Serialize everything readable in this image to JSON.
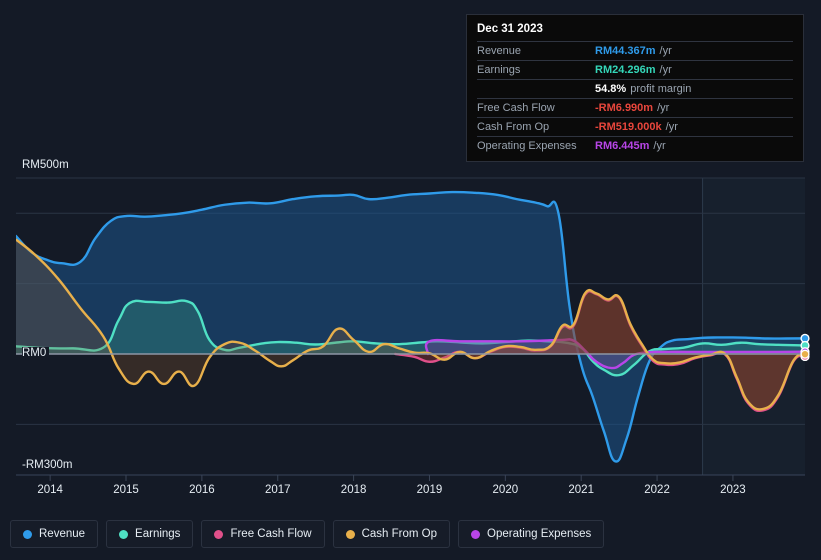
{
  "tooltip": {
    "date": "Dec 31 2023",
    "rows": [
      {
        "label": "Revenue",
        "value": "RM44.367m",
        "unit": "/yr",
        "color": "#2f9bea"
      },
      {
        "label": "Earnings",
        "value": "RM24.296m",
        "unit": "/yr",
        "color": "#34d6b8"
      },
      {
        "label": "",
        "value": "54.8%",
        "unit": "profit margin",
        "color": "#ffffff"
      },
      {
        "label": "Free Cash Flow",
        "value": "-RM6.990m",
        "unit": "/yr",
        "color": "#e8463c"
      },
      {
        "label": "Cash From Op",
        "value": "-RM519.000k",
        "unit": "/yr",
        "color": "#e8463c"
      },
      {
        "label": "Operating Expenses",
        "value": "RM6.445m",
        "unit": "/yr",
        "color": "#b845e8"
      }
    ]
  },
  "legend": {
    "items": [
      {
        "label": "Revenue",
        "color": "#2f9bea"
      },
      {
        "label": "Earnings",
        "color": "#4fe0c4"
      },
      {
        "label": "Free Cash Flow",
        "color": "#e0508a"
      },
      {
        "label": "Cash From Op",
        "color": "#e8b04b"
      },
      {
        "label": "Operating Expenses",
        "color": "#b845e8"
      }
    ]
  },
  "axes": {
    "y_labels": [
      "RM500m",
      "RM0",
      "-RM300m"
    ],
    "x_labels": [
      "2014",
      "2015",
      "2016",
      "2017",
      "2018",
      "2019",
      "2020",
      "2021",
      "2022",
      "2023"
    ]
  },
  "chart_data": {
    "type": "area",
    "title": "",
    "xlabel": "",
    "ylabel": "",
    "currency": "RM",
    "ylim": [
      -300,
      500
    ],
    "xlim": [
      2013.55,
      2023.95
    ],
    "grid": true,
    "legend_position": "bottom",
    "y_ticks": [
      500,
      400,
      200,
      0,
      -200
    ],
    "y_tick_labels": [
      "RM500m",
      "",
      "",
      "RM0",
      "-RM300m"
    ],
    "x_ticks": [
      2014,
      2015,
      2016,
      2017,
      2018,
      2019,
      2020,
      2021,
      2022,
      2023
    ],
    "forecast_region_start": 2022.6,
    "series": [
      {
        "name": "Revenue",
        "color": "#2f9bea",
        "fill": "rgba(27,86,140,0.55)",
        "x": [
          2013.55,
          2013.75,
          2013.95,
          2014.15,
          2014.4,
          2014.6,
          2014.8,
          2015.0,
          2015.25,
          2015.5,
          2015.75,
          2016.0,
          2016.3,
          2016.6,
          2016.9,
          2017.2,
          2017.5,
          2017.8,
          2018.0,
          2018.2,
          2018.45,
          2018.7,
          2019.0,
          2019.3,
          2019.6,
          2019.9,
          2020.15,
          2020.4,
          2020.55,
          2020.7,
          2020.85,
          2021.0,
          2021.15,
          2021.3,
          2021.45,
          2021.6,
          2021.75,
          2021.9,
          2022.05,
          2022.2,
          2022.4,
          2022.6,
          2022.8,
          2023.0,
          2023.2,
          2023.45,
          2023.7,
          2023.95
        ],
        "y": [
          335,
          290,
          268,
          258,
          262,
          330,
          378,
          392,
          390,
          394,
          400,
          410,
          424,
          430,
          428,
          440,
          448,
          450,
          452,
          440,
          444,
          452,
          456,
          460,
          458,
          452,
          440,
          430,
          420,
          400,
          130,
          -30,
          -120,
          -220,
          -305,
          -240,
          -120,
          -20,
          20,
          38,
          42,
          46,
          47,
          47,
          46,
          44,
          44,
          44.367
        ]
      },
      {
        "name": "Earnings",
        "color": "#4fe0c4",
        "fill": "rgba(46,130,122,0.45)",
        "x": [
          2013.55,
          2013.9,
          2014.3,
          2014.7,
          2014.9,
          2015.05,
          2015.3,
          2015.55,
          2015.8,
          2015.95,
          2016.1,
          2016.3,
          2016.5,
          2016.8,
          2017.0,
          2017.25,
          2017.5,
          2017.8,
          2018.0,
          2018.3,
          2018.6,
          2018.9,
          2019.1,
          2019.4,
          2019.7,
          2020.0,
          2020.3,
          2020.55,
          2020.8,
          2021.0,
          2021.15,
          2021.3,
          2021.5,
          2021.7,
          2021.9,
          2022.1,
          2022.35,
          2022.6,
          2022.85,
          2023.1,
          2023.35,
          2023.6,
          2023.95
        ],
        "y": [
          22,
          17,
          16,
          18,
          95,
          145,
          148,
          146,
          150,
          120,
          40,
          12,
          18,
          30,
          34,
          32,
          27,
          33,
          36,
          30,
          28,
          33,
          36,
          33,
          30,
          34,
          38,
          36,
          32,
          18,
          -20,
          -45,
          -60,
          -30,
          8,
          14,
          18,
          30,
          26,
          32,
          28,
          26,
          24.296
        ]
      },
      {
        "name": "Free Cash Flow",
        "color": "#e0508a",
        "fill": "rgba(140,52,52,0.45)",
        "x": [
          2018.55,
          2018.8,
          2019.0,
          2019.2,
          2019.4,
          2019.6,
          2019.8,
          2020.0,
          2020.2,
          2020.4,
          2020.6,
          2020.75,
          2020.9,
          2021.05,
          2021.2,
          2021.35,
          2021.5,
          2021.65,
          2021.8,
          2021.95,
          2022.1,
          2022.3,
          2022.5,
          2022.7,
          2022.9,
          2023.05,
          2023.2,
          2023.4,
          2023.6,
          2023.8,
          2023.95
        ],
        "y": [
          0,
          -8,
          -22,
          -10,
          6,
          -12,
          6,
          20,
          18,
          10,
          22,
          76,
          80,
          168,
          170,
          152,
          160,
          80,
          24,
          -20,
          -30,
          -28,
          -12,
          -4,
          -2,
          -70,
          -140,
          -160,
          -120,
          -20,
          -6.99
        ]
      },
      {
        "name": "Cash From Op",
        "color": "#e8b04b",
        "fill": "rgba(150,95,45,0.25)",
        "x": [
          2013.55,
          2013.8,
          2014.1,
          2014.4,
          2014.7,
          2014.9,
          2015.1,
          2015.3,
          2015.5,
          2015.7,
          2015.9,
          2016.1,
          2016.3,
          2016.5,
          2016.7,
          2016.9,
          2017.05,
          2017.2,
          2017.4,
          2017.6,
          2017.8,
          2018.0,
          2018.2,
          2018.4,
          2018.6,
          2018.8,
          2019.0,
          2019.2,
          2019.4,
          2019.6,
          2019.8,
          2020.0,
          2020.2,
          2020.4,
          2020.6,
          2020.75,
          2020.9,
          2021.05,
          2021.2,
          2021.35,
          2021.5,
          2021.65,
          2021.8,
          2021.95,
          2022.1,
          2022.3,
          2022.5,
          2022.7,
          2022.9,
          2023.05,
          2023.2,
          2023.4,
          2023.6,
          2023.8,
          2023.95
        ],
        "y": [
          325,
          282,
          215,
          130,
          50,
          -40,
          -85,
          -50,
          -85,
          -50,
          -90,
          -10,
          28,
          32,
          10,
          -20,
          -35,
          -18,
          10,
          22,
          72,
          40,
          6,
          28,
          16,
          4,
          2,
          -16,
          6,
          -12,
          8,
          22,
          20,
          12,
          24,
          80,
          84,
          172,
          172,
          155,
          162,
          84,
          28,
          -16,
          -26,
          -24,
          -10,
          -2,
          0,
          -66,
          -136,
          -156,
          -116,
          -18,
          -0.519
        ]
      },
      {
        "name": "Operating Expenses",
        "color": "#b845e8",
        "fill": "rgba(110,50,150,0.40)",
        "x": [
          2018.98,
          2019.0,
          2019.4,
          2019.8,
          2020.2,
          2020.5,
          2020.75,
          2020.9,
          2021.05,
          2021.2,
          2021.4,
          2021.55,
          2021.7,
          2021.9,
          2022.1,
          2022.4,
          2022.8,
          2023.2,
          2023.6,
          2023.95
        ],
        "y": [
          0,
          36,
          36,
          36,
          36,
          38,
          40,
          38,
          10,
          -22,
          -40,
          -26,
          -2,
          5,
          6,
          6,
          6,
          6,
          6,
          6.445
        ]
      }
    ]
  }
}
